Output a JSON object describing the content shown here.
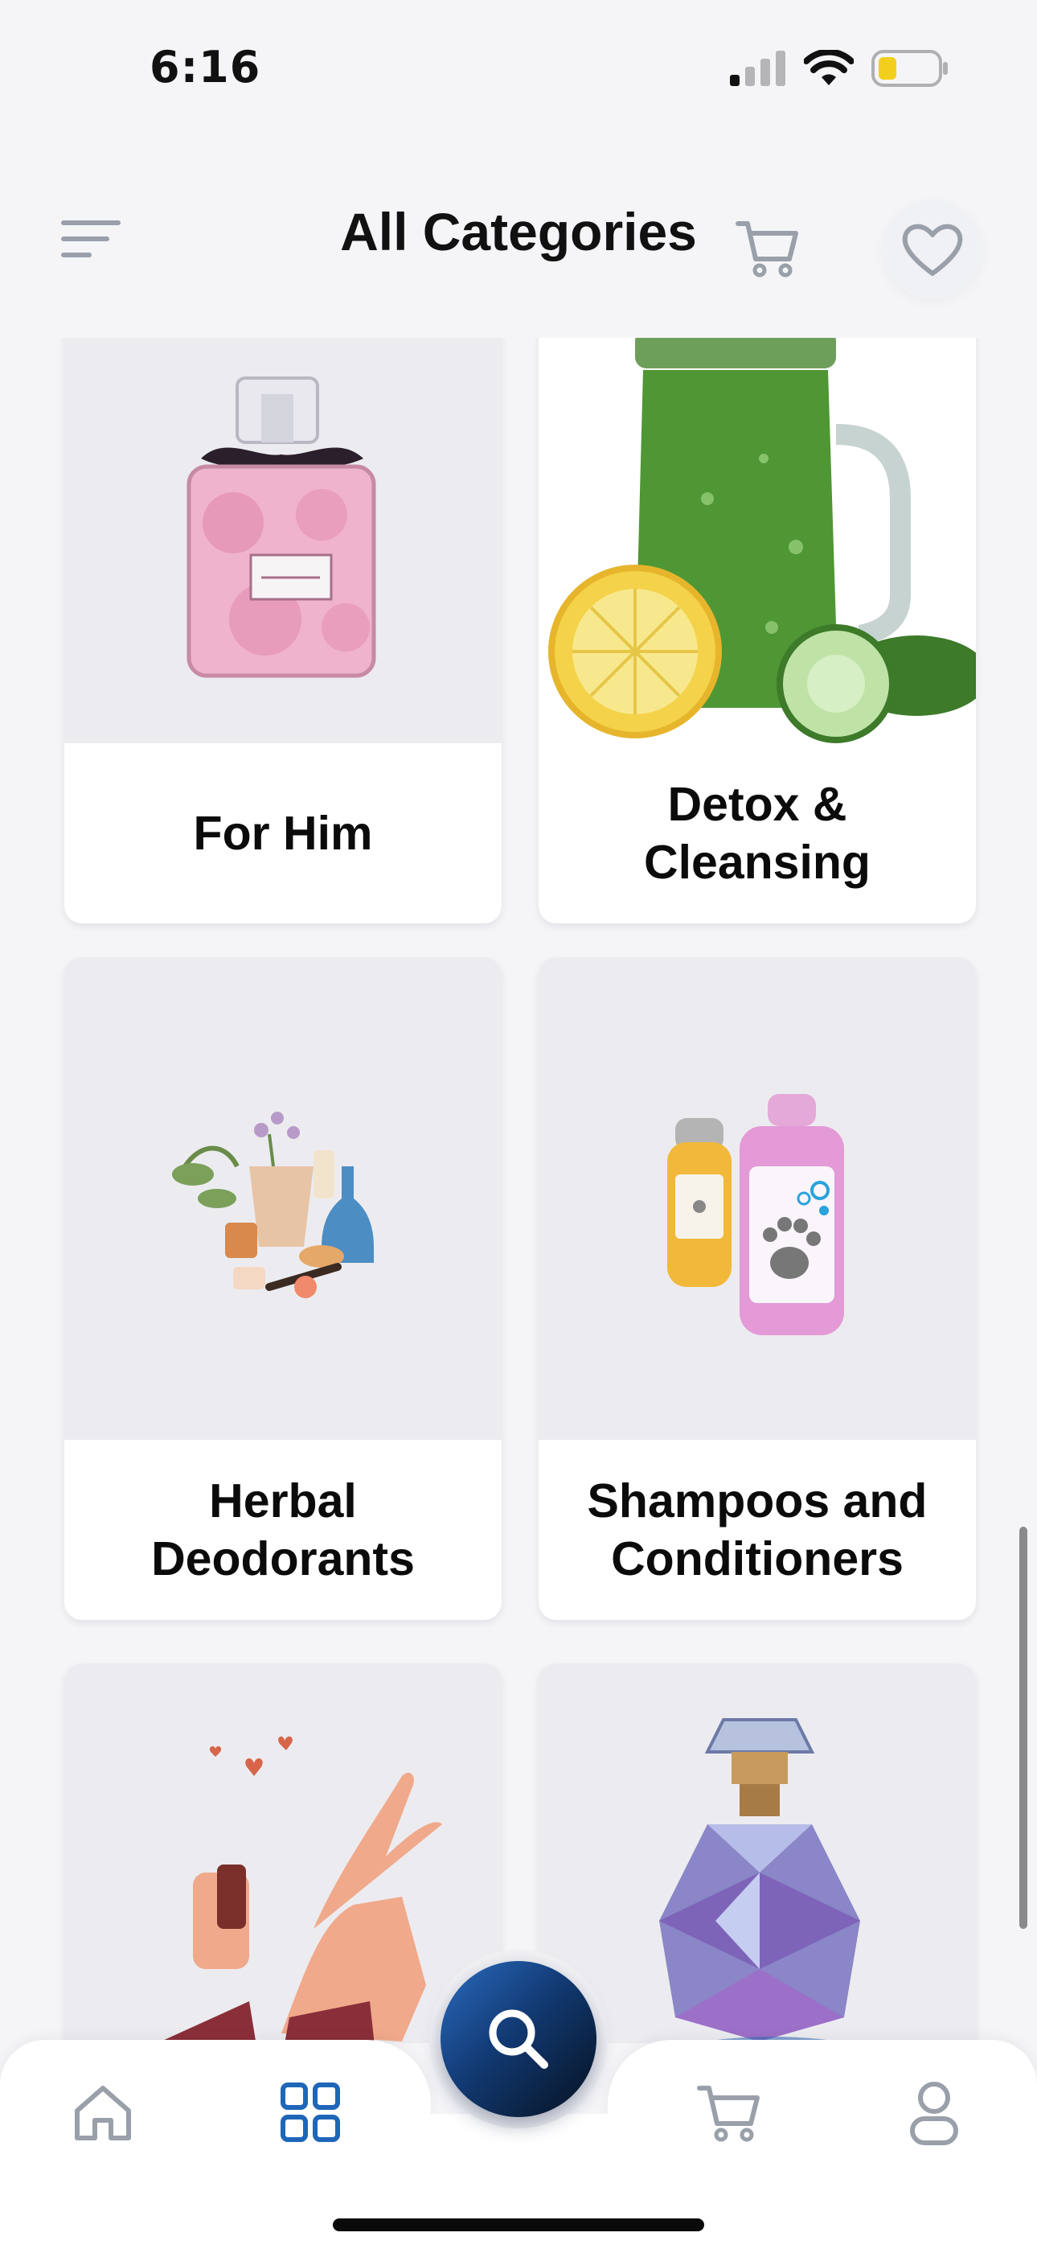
{
  "status_bar": {
    "time": "6:16"
  },
  "header": {
    "title": "All Categories"
  },
  "categories": [
    {
      "label": "For Him",
      "icon": "perfume-bottle-pink"
    },
    {
      "label": "Detox & Cleansing",
      "icon": "green-smoothie-jar"
    },
    {
      "label": "Herbal Deodorants",
      "icon": "herbal-jars"
    },
    {
      "label": "Shampoos and Conditioners",
      "icon": "pet-shampoo-bottles"
    },
    {
      "label": "",
      "icon": "hands-perfume-spray"
    },
    {
      "label": "",
      "icon": "crystal-perfume-bottle"
    }
  ],
  "bottom_nav": {
    "items": [
      "home-icon",
      "categories-icon",
      "search-icon",
      "cart-icon",
      "profile-icon"
    ],
    "active": "categories-icon"
  },
  "colors": {
    "accent": "#1f66b8",
    "icon_gray": "#9aa0aa",
    "fab_dark": "#0b1f3f"
  }
}
